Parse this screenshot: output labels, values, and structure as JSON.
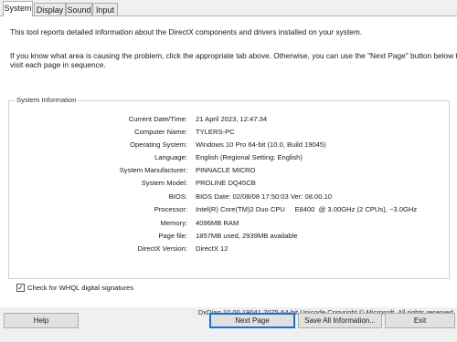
{
  "tabs": [
    {
      "label": "System",
      "active": true
    },
    {
      "label": "Display",
      "active": false
    },
    {
      "label": "Sound",
      "active": false
    },
    {
      "label": "Input",
      "active": false
    }
  ],
  "intro": {
    "line1": "This tool reports detailed information about the DirectX components and drivers installed on your system.",
    "line2": "If you know what area is causing the problem, click the appropriate tab above.  Otherwise, you can use the \"Next Page\" button below to",
    "line3": "visit each page in sequence."
  },
  "system_info": {
    "title": "System Information",
    "rows": [
      {
        "label": "Current Date/Time:",
        "value": "21 April 2023, 12:47:34"
      },
      {
        "label": "Computer Name:",
        "value": "TYLERS-PC"
      },
      {
        "label": "Operating System:",
        "value": "Windows 10 Pro 64-bit (10.0, Build 19045)"
      },
      {
        "label": "Language:",
        "value": "English (Regional Setting: English)"
      },
      {
        "label": "System Manufacturer:",
        "value": "PINNACLE MICRO"
      },
      {
        "label": "System Model:",
        "value": "PROLINE DQ45CB"
      },
      {
        "label": "BIOS:",
        "value": "BIOS Date: 02/08/08 17:50:03 Ver: 08.00.10"
      },
      {
        "label": "Processor:",
        "value": "Intel(R) Core(TM)2 Duo CPU     E8400  @ 3.00GHz (2 CPUs), ~3.0GHz"
      },
      {
        "label": "Memory:",
        "value": "4096MB RAM"
      },
      {
        "label": "Page file:",
        "value": "1857MB used, 2939MB available"
      },
      {
        "label": "DirectX Version:",
        "value": "DirectX 12"
      }
    ]
  },
  "whql_checkbox": {
    "label": "Check for WHQL digital signatures",
    "checked": true,
    "mark": "✓"
  },
  "footer": "DxDiag 10.00.19041.2075 64-bit Unicode  Copyright © Microsoft. All rights reserved.",
  "buttons": {
    "help": "Help",
    "next_page": "Next Page",
    "save_all": "Save All Information...",
    "exit": "Exit"
  }
}
